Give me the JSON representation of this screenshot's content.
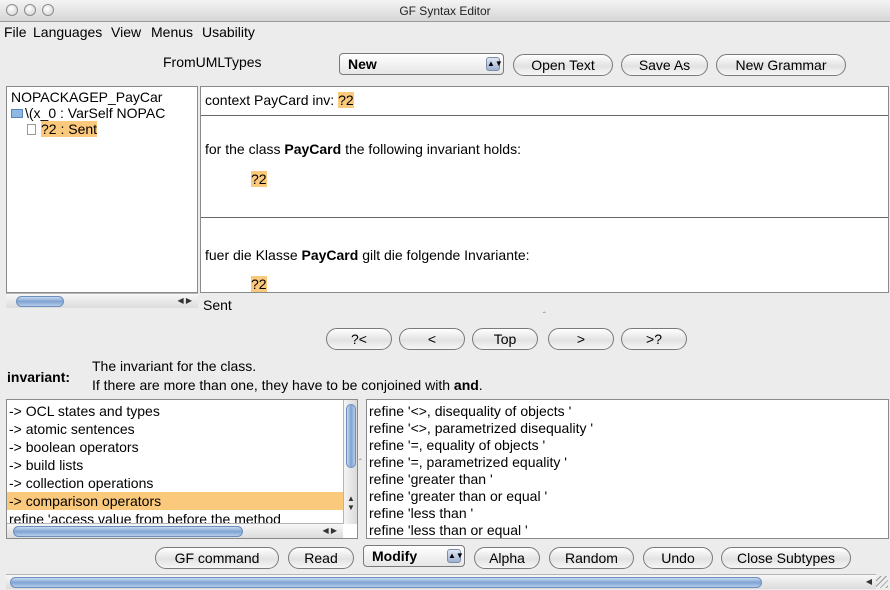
{
  "window": {
    "title": "GF Syntax Editor"
  },
  "menu": [
    "File",
    "Languages",
    "View",
    "Menus",
    "Usability"
  ],
  "toolbar": {
    "grammar_label": "FromUMLTypes",
    "new_select": "New",
    "open_text": "Open Text",
    "save_as": "Save As",
    "new_grammar": "New Grammar"
  },
  "tree": {
    "root": "NOPACKAGEP_PayCar",
    "child": "\\(x_0 : VarSelf NOPAC",
    "leaf": "?2 : Sent"
  },
  "editor": {
    "ocl_prefix": "context PayCard inv:",
    "ocl_meta": "?2",
    "en_prefix": "for the class",
    "en_class": "PayCard",
    "en_suffix": "the following invariant holds:",
    "en_meta": "?2",
    "de_prefix": "fuer die Klasse",
    "de_class": "PayCard",
    "de_suffix": "gilt die folgende Invariante:",
    "de_meta": "?2"
  },
  "status_category": "Sent",
  "nav": [
    "?<",
    "<",
    "Top",
    ">",
    ">?"
  ],
  "help": {
    "label": "invariant:",
    "line1": "The invariant for the class.",
    "line2_prefix": "If there are more than one, they have to be conjoined with",
    "line2_bold": "and",
    "line2_end": "."
  },
  "categories": [
    "-> OCL states and types",
    "-> atomic sentences",
    "-> boolean operators",
    "-> build lists",
    "-> collection operations",
    "-> comparison operators",
    "refine 'access value from before the method"
  ],
  "refinements": [
    "refine '<>, disequality of objects  '",
    "refine '<>, parametrized disequality  '",
    "refine '=, equality of objects  '",
    "refine '=, parametrized equality  '",
    "refine 'greater than '",
    "refine 'greater than or equal '",
    "refine 'less than '",
    "refine 'less than or equal '"
  ],
  "bottom": {
    "gf_command": "GF command",
    "read": "Read",
    "modify_select": "Modify",
    "alpha": "Alpha",
    "random": "Random",
    "undo": "Undo",
    "close_subtypes": "Close Subtypes"
  }
}
